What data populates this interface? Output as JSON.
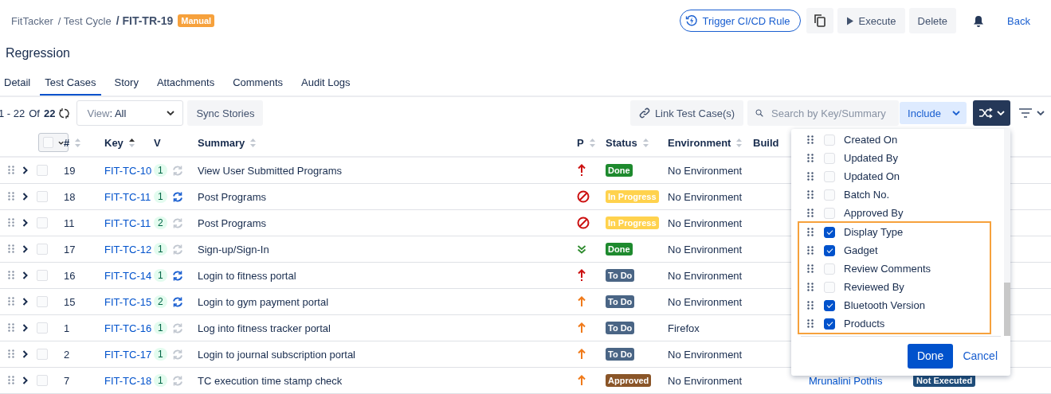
{
  "breadcrumbs": {
    "project": "FitTacker",
    "section": "/ Test Cycle",
    "current": "/ FIT-TR-19",
    "badge": "Manual"
  },
  "actions": {
    "trigger": "Trigger CI/CD Rule",
    "execute": "Execute",
    "delete": "Delete",
    "back": "Back"
  },
  "title": "Regression",
  "tabs": [
    {
      "label": "Detail",
      "selected": false
    },
    {
      "label": "Test Cases",
      "selected": true
    },
    {
      "label": "Story",
      "selected": false
    },
    {
      "label": "Attachments",
      "selected": false
    },
    {
      "label": "Comments",
      "selected": false
    },
    {
      "label": "Audit Logs",
      "selected": false
    }
  ],
  "toolbar": {
    "range": "1 - 22",
    "of": "Of",
    "total": "22",
    "view_label": "View",
    "view_value": ": All",
    "sync": "Sync Stories",
    "link": "Link Test Case(s)",
    "search_placeholder": "Search by Key/Summary",
    "include": "Include"
  },
  "table": {
    "columns": [
      "#",
      "Key",
      "V",
      "Summary",
      "P",
      "Status",
      "Environment",
      "Build"
    ],
    "select_all": {
      "checked": false
    },
    "rows": [
      {
        "num": "19",
        "key": "FIT-TC-10",
        "version": "1",
        "synced": false,
        "summary": "View User Submitted Programs",
        "checked": false,
        "priority": {
          "kind": "highest"
        },
        "status": {
          "label": "Done",
          "color": "#1e8a2e"
        },
        "environment": "No Environment"
      },
      {
        "num": "18",
        "key": "FIT-TC-11",
        "version": "1",
        "synced": true,
        "summary": "Post Programs",
        "checked": false,
        "priority": {
          "kind": "blocker"
        },
        "status": {
          "label": "In Progress",
          "color": "#ffd24d"
        },
        "environment": "No Environment"
      },
      {
        "num": "11",
        "key": "FIT-TC-11",
        "version": "2",
        "synced": false,
        "summary": "Post Programs",
        "checked": false,
        "priority": {
          "kind": "blocker"
        },
        "status": {
          "label": "In Progress",
          "color": "#ffd24d"
        },
        "environment": "No Environment"
      },
      {
        "num": "17",
        "key": "FIT-TC-12",
        "version": "1",
        "synced": false,
        "summary": "Sign-up/Sign-In",
        "checked": false,
        "priority": {
          "kind": "lowest"
        },
        "status": {
          "label": "Done",
          "color": "#1e8a2e"
        },
        "environment": "No Environment"
      },
      {
        "num": "16",
        "key": "FIT-TC-14",
        "version": "1",
        "synced": true,
        "summary": "Login to fitness portal",
        "checked": false,
        "priority": {
          "kind": "highest"
        },
        "status": {
          "label": "To Do",
          "color": "#4a6585"
        },
        "environment": "No Environment"
      },
      {
        "num": "15",
        "key": "FIT-TC-15",
        "version": "2",
        "synced": true,
        "summary": "Login to gym payment portal",
        "checked": false,
        "priority": {
          "kind": "high"
        },
        "status": {
          "label": "To Do",
          "color": "#4a6585"
        },
        "environment": "No Environment"
      },
      {
        "num": "1",
        "key": "FIT-TC-16",
        "version": "1",
        "synced": false,
        "summary": "Log into fitness tracker portal",
        "checked": false,
        "priority": {
          "kind": "high"
        },
        "status": {
          "label": "To Do",
          "color": "#4a6585"
        },
        "environment": "Firefox"
      },
      {
        "num": "2",
        "key": "FIT-TC-17",
        "version": "1",
        "synced": false,
        "summary": "Login to journal subscription portal",
        "checked": false,
        "priority": {
          "kind": "high"
        },
        "status": {
          "label": "To Do",
          "color": "#4a6585"
        },
        "environment": "No Environment"
      },
      {
        "num": "7",
        "key": "FIT-TC-18",
        "version": "1",
        "synced": false,
        "summary": "TC execution time stamp check",
        "checked": false,
        "priority": {
          "kind": "high"
        },
        "status": {
          "label": "Approved",
          "color": "#8a5528"
        },
        "environment": "No Environment",
        "assignee": "Mrunalini Pothis",
        "execution": "Not Executed"
      }
    ]
  },
  "columns_menu": {
    "items": [
      {
        "label": "Created On",
        "checked": false
      },
      {
        "label": "Updated By",
        "checked": false
      },
      {
        "label": "Updated On",
        "checked": false
      },
      {
        "label": "Batch No.",
        "checked": false
      },
      {
        "label": "Approved By",
        "checked": false
      }
    ],
    "highlighted_items": [
      {
        "label": "Display Type",
        "checked": true
      },
      {
        "label": "Gadget",
        "checked": true
      },
      {
        "label": "Review Comments",
        "checked": false
      },
      {
        "label": "Reviewed By",
        "checked": false
      },
      {
        "label": "Bluetooth Version",
        "checked": true
      },
      {
        "label": "Products",
        "checked": true
      }
    ],
    "done": "Done",
    "cancel": "Cancel"
  }
}
